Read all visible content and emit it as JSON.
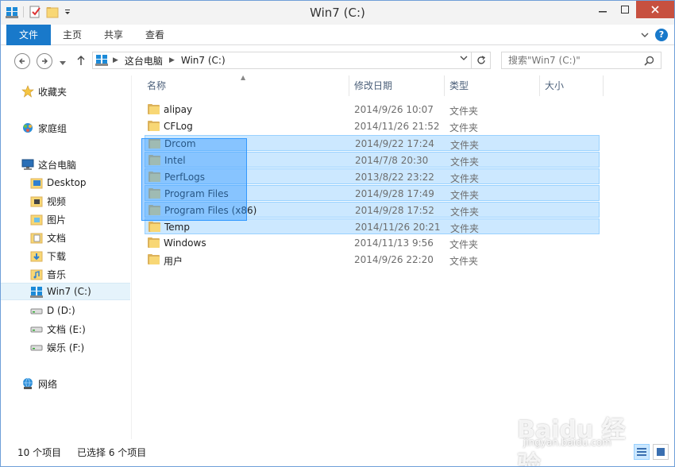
{
  "window": {
    "title": "Win7 (C:)"
  },
  "ribbon": {
    "tabs": [
      "文件",
      "主页",
      "共享",
      "查看"
    ],
    "help": "?"
  },
  "address": {
    "crumbs": [
      "这台电脑",
      "Win7 (C:)"
    ]
  },
  "search": {
    "placeholder": "搜索\"Win7 (C:)\""
  },
  "navpane": {
    "favorites": "收藏夹",
    "homegroup": "家庭组",
    "thispc": "这台电脑",
    "items": [
      "Desktop",
      "视频",
      "图片",
      "文档",
      "下载",
      "音乐",
      "Win7 (C:)",
      "D  (D:)",
      "文档 (E:)",
      "娱乐 (F:)"
    ],
    "network": "网络"
  },
  "columns": {
    "name": "名称",
    "date": "修改日期",
    "type": "类型",
    "size": "大小"
  },
  "files": [
    {
      "name": "alipay",
      "date": "2014/9/26 10:07",
      "type": "文件夹",
      "selected": false
    },
    {
      "name": "CFLog",
      "date": "2014/11/26 21:52",
      "type": "文件夹",
      "selected": false
    },
    {
      "name": "Drcom",
      "date": "2014/9/22 17:24",
      "type": "文件夹",
      "selected": true
    },
    {
      "name": "Intel",
      "date": "2014/7/8 20:30",
      "type": "文件夹",
      "selected": true
    },
    {
      "name": "PerfLogs",
      "date": "2013/8/22 23:22",
      "type": "文件夹",
      "selected": true
    },
    {
      "name": "Program Files",
      "date": "2014/9/28 17:49",
      "type": "文件夹",
      "selected": true
    },
    {
      "name": "Program Files (x86)",
      "date": "2014/9/28 17:52",
      "type": "文件夹",
      "selected": true
    },
    {
      "name": "Temp",
      "date": "2014/11/26 20:21",
      "type": "文件夹",
      "selected": true
    },
    {
      "name": "Windows",
      "date": "2014/11/13 9:56",
      "type": "文件夹",
      "selected": false
    },
    {
      "name": "用户",
      "date": "2014/9/26 22:20",
      "type": "文件夹",
      "selected": false
    }
  ],
  "status": {
    "count": "10 个项目",
    "selected": "已选择 6 个项目"
  },
  "watermark": {
    "logo": "Baidu 经验",
    "site": "jingyan.baidu.com"
  }
}
